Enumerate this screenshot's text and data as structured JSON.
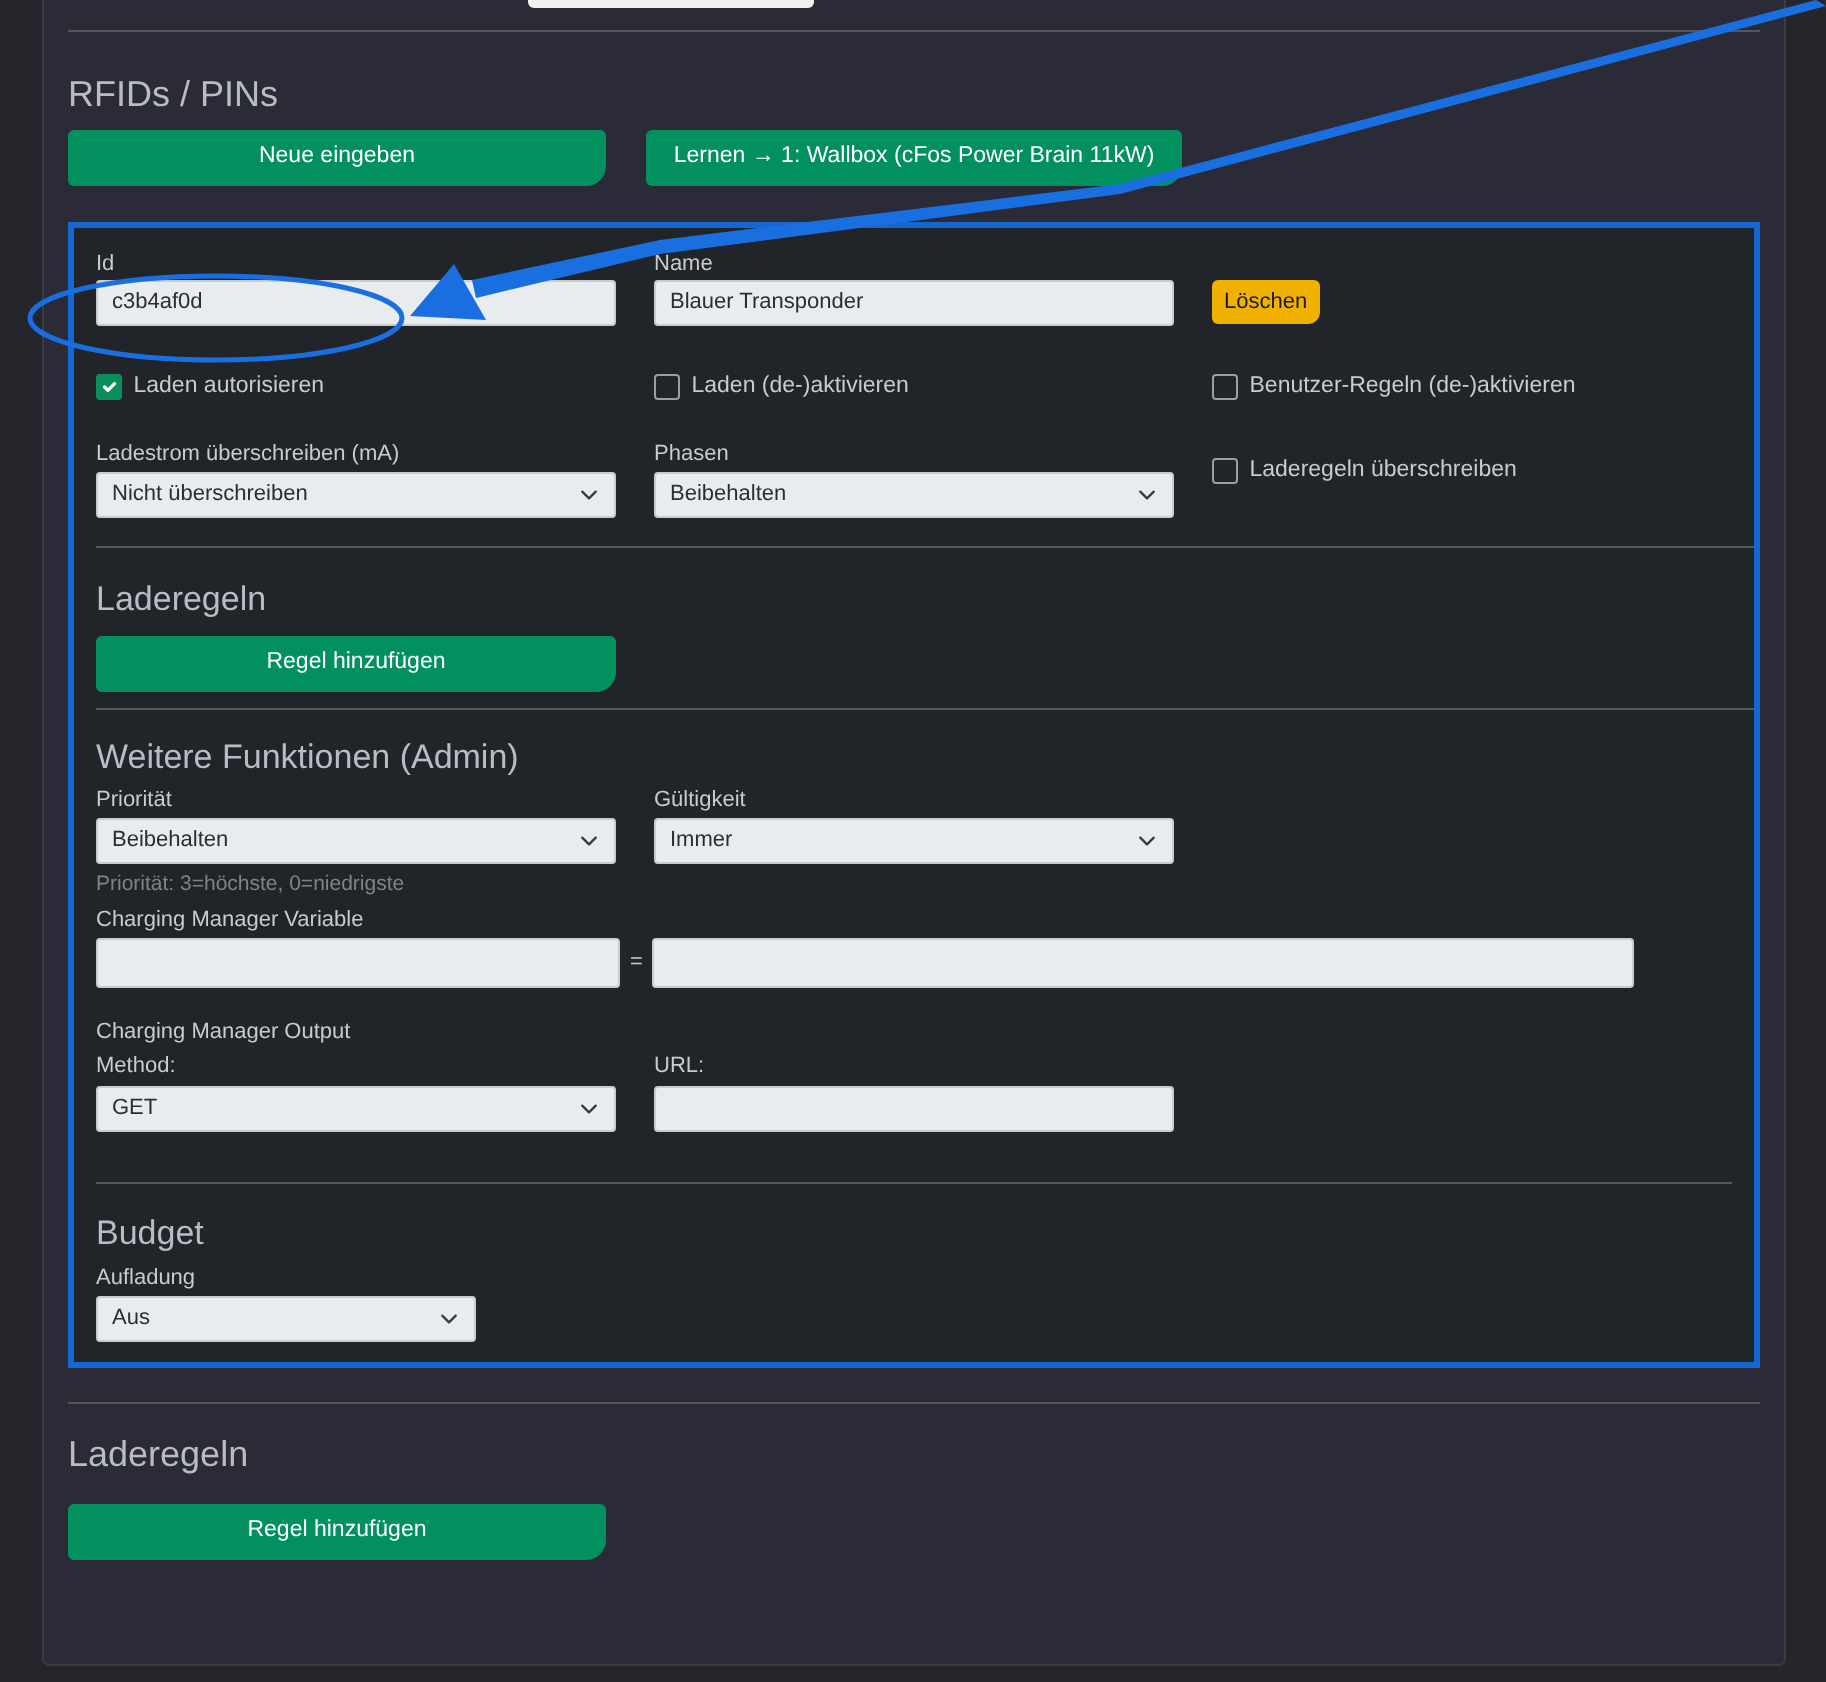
{
  "section_title": "RFIDs / PINs",
  "buttons": [
    {
      "label": "Neue eingeben"
    },
    {
      "label": "Lernen → 1: Wallbox (cFos Power Brain 11kW)"
    }
  ],
  "rfid": {
    "id": {
      "label": "Id",
      "value": "c3b4af0d"
    },
    "name": {
      "label": "Name",
      "value": "Blauer Transponder"
    },
    "delete_button": "Löschen",
    "checkboxes": [
      {
        "label": "Laden autorisieren",
        "checked": true
      },
      {
        "label": "Laden (de-)aktivieren",
        "checked": false
      },
      {
        "label": "Benutzer-Regeln (de-)aktivieren",
        "checked": false
      }
    ],
    "current_override": {
      "label": "Ladestrom überschreiben (mA)",
      "value": "Nicht überschreiben"
    },
    "phases": {
      "label": "Phasen",
      "value": "Beibehalten"
    },
    "override_rules": {
      "label": "Laderegeln überschreiben",
      "checked": false
    },
    "charging_rules": {
      "title": "Laderegeln",
      "button": "Regel hinzufügen"
    },
    "admin": {
      "title": "Weitere Funktionen (Admin)",
      "priority": {
        "label": "Priorität",
        "value": "Beibehalten",
        "help": "Priorität: 3=höchste, 0=niedrigste"
      },
      "validity": {
        "label": "Gültigkeit",
        "value": "Immer"
      },
      "variable_label": "Charging Manager Variable",
      "equals": "=",
      "output_label": "Charging Manager Output",
      "method": {
        "label": "Method:",
        "value": "GET"
      },
      "url": {
        "label": "URL:"
      }
    },
    "budget": {
      "title": "Budget",
      "charging": {
        "label": "Aufladung",
        "value": "Aus"
      }
    }
  },
  "charging_rules": {
    "title": "Laderegeln",
    "button": "Regel hinzufügen"
  }
}
